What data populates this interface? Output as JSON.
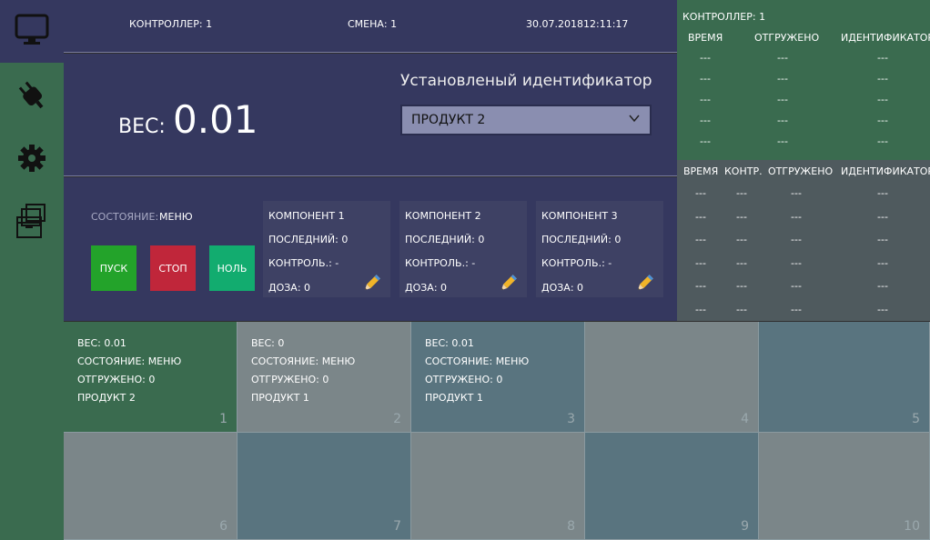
{
  "header": {
    "controller": "КОНТРОЛЛЕР: 1",
    "shift": "СМЕНА: 1",
    "date": "30.07.2018",
    "time": "12:11:17"
  },
  "sidebar": {
    "icons": [
      "monitor-icon",
      "plug-icon",
      "gear-icon",
      "archive-icon"
    ]
  },
  "weight": {
    "label": "ВЕС:",
    "value": "0.01"
  },
  "identifier": {
    "label": "Установленый идентификатор",
    "selected": "ПРОДУКТ 2"
  },
  "control": {
    "state_label": "СОСТОЯНИЕ:",
    "state_value": "МЕНЮ",
    "start_label": "ПУСК",
    "stop_label": "СТОП",
    "zero_label": "НОЛЬ"
  },
  "components": [
    {
      "title": "КОМПОНЕНТ 1",
      "last": "ПОСЛЕДНИЙ: 0",
      "control": "КОНТРОЛЬ.: -",
      "dose": "ДОЗА: 0"
    },
    {
      "title": "КОМПОНЕНТ 2",
      "last": "ПОСЛЕДНИЙ: 0",
      "control": "КОНТРОЛЬ.: -",
      "dose": "ДОЗА: 0"
    },
    {
      "title": "КОМПОНЕНТ 3",
      "last": "ПОСЛЕДНИЙ: 0",
      "control": "КОНТРОЛЬ.: -",
      "dose": "ДОЗА: 0"
    }
  ],
  "right_top": {
    "controller": "КОНТРОЛЛЕР: 1",
    "headers": [
      "ВРЕМЯ",
      "ОТГРУЖЕНО",
      "ИДЕНТИФИКАТОР"
    ],
    "rows": [
      [
        "---",
        "---",
        "---"
      ],
      [
        "---",
        "---",
        "---"
      ],
      [
        "---",
        "---",
        "---"
      ],
      [
        "---",
        "---",
        "---"
      ],
      [
        "---",
        "---",
        "---"
      ]
    ]
  },
  "right_bottom": {
    "headers": [
      "ВРЕМЯ",
      "КОНТР.",
      "ОТГРУЖЕНО",
      "ИДЕНТИФИКАТОР"
    ],
    "rows": [
      [
        "---",
        "---",
        "---",
        "---"
      ],
      [
        "---",
        "---",
        "---",
        "---"
      ],
      [
        "---",
        "---",
        "---",
        "---"
      ],
      [
        "---",
        "---",
        "---",
        "---"
      ],
      [
        "---",
        "---",
        "---",
        "---"
      ],
      [
        "---",
        "---",
        "---",
        "---"
      ]
    ]
  },
  "tiles": [
    {
      "num": "1",
      "lines": [
        "ВЕС: 0.01",
        "СОСТОЯНИЕ: МЕНЮ",
        "ОТГРУЖЕНО: 0",
        "ПРОДУКТ 2"
      ],
      "color": "#3a6b4f"
    },
    {
      "num": "2",
      "lines": [
        "ВЕС: 0",
        "СОСТОЯНИЕ: МЕНЮ",
        "ОТГРУЖЕНО: 0",
        "ПРОДУКТ 1"
      ],
      "color": "#7b8689"
    },
    {
      "num": "3",
      "lines": [
        "ВЕС: 0.01",
        "СОСТОЯНИЕ: МЕНЮ",
        "ОТГРУЖЕНО: 0",
        "ПРОДУКТ 1"
      ],
      "color": "#59747f"
    },
    {
      "num": "4",
      "lines": [],
      "color": "#7b8689"
    },
    {
      "num": "5",
      "lines": [],
      "color": "#59747f"
    },
    {
      "num": "6",
      "lines": [],
      "color": "#7b8689"
    },
    {
      "num": "7",
      "lines": [],
      "color": "#59747f"
    },
    {
      "num": "8",
      "lines": [],
      "color": "#7b8689"
    },
    {
      "num": "9",
      "lines": [],
      "color": "#59747f"
    },
    {
      "num": "10",
      "lines": [],
      "color": "#7b8689"
    }
  ]
}
